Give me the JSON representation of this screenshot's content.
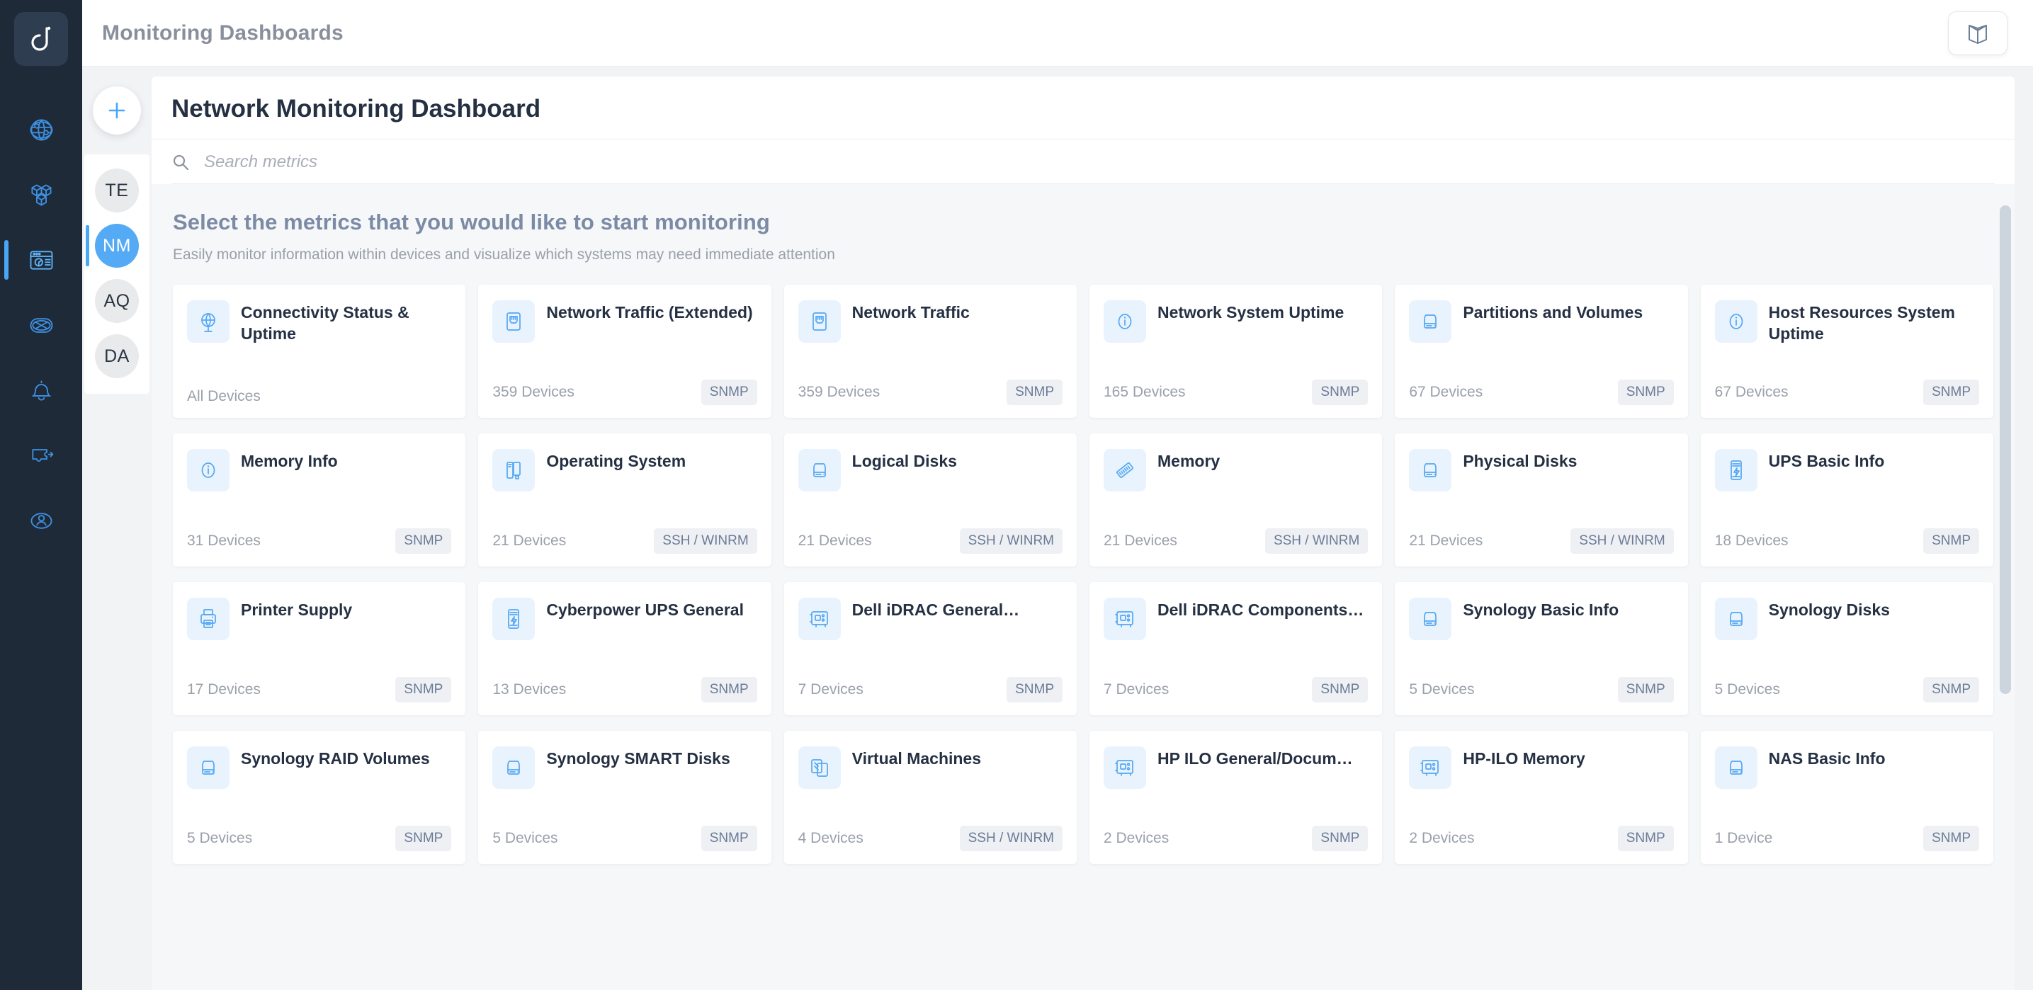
{
  "sidebar": {
    "logo": "logo-d-icon",
    "items": [
      {
        "name": "network",
        "icon": "globe-network-icon",
        "active": false
      },
      {
        "name": "inventory",
        "icon": "cubes-icon",
        "active": false
      },
      {
        "name": "dashboards",
        "icon": "dashboard-window-icon",
        "active": true
      },
      {
        "name": "discovery",
        "icon": "compass-icon",
        "active": false
      },
      {
        "name": "alerts",
        "icon": "bell-icon",
        "active": false
      },
      {
        "name": "integrations",
        "icon": "puzzle-piece-icon",
        "active": false
      },
      {
        "name": "account",
        "icon": "user-circle-icon",
        "active": false
      }
    ]
  },
  "topbar": {
    "title": "Monitoring Dashboards",
    "doc_button_icon": "book-icon"
  },
  "switcher": {
    "add_label": "+",
    "add_icon": "plus-icon",
    "dashboards": [
      {
        "initials": "TE",
        "active": false
      },
      {
        "initials": "NM",
        "active": true
      },
      {
        "initials": "AQ",
        "active": false
      },
      {
        "initials": "DA",
        "active": false
      }
    ]
  },
  "panel": {
    "title": "Network Monitoring Dashboard"
  },
  "search": {
    "placeholder": "Search metrics",
    "value": "",
    "icon": "search-icon"
  },
  "section": {
    "heading": "Select the metrics that you would like to start monitoring",
    "subheading": "Easily monitor information within devices and visualize which systems may need immediate attention"
  },
  "colors": {
    "accent": "#49a7f5",
    "rail_bg": "#1e2a38",
    "card_icon_bg": "#e9f3fe",
    "tag_bg": "#eef0f4",
    "heading": "#7c8ba5"
  },
  "metrics": [
    {
      "name": "Connectivity Status & Uptime",
      "devices": "All Devices",
      "tag": "",
      "icon": "globe-icon"
    },
    {
      "name": "Network Traffic (Extended)",
      "devices": "359 Devices",
      "tag": "SNMP",
      "icon": "ethernet-port-icon"
    },
    {
      "name": "Network Traffic",
      "devices": "359 Devices",
      "tag": "SNMP",
      "icon": "ethernet-port-icon"
    },
    {
      "name": "Network System Uptime",
      "devices": "165 Devices",
      "tag": "SNMP",
      "icon": "info-icon"
    },
    {
      "name": "Partitions and Volumes",
      "devices": "67 Devices",
      "tag": "SNMP",
      "icon": "disk-icon"
    },
    {
      "name": "Host Resources System Uptime",
      "devices": "67 Devices",
      "tag": "SNMP",
      "icon": "info-icon"
    },
    {
      "name": "Memory Info",
      "devices": "31 Devices",
      "tag": "SNMP",
      "icon": "info-icon"
    },
    {
      "name": "Operating System",
      "devices": "21 Devices",
      "tag": "SSH / WINRM",
      "icon": "os-window-icon"
    },
    {
      "name": "Logical Disks",
      "devices": "21 Devices",
      "tag": "SSH / WINRM",
      "icon": "disk-icon"
    },
    {
      "name": "Memory",
      "devices": "21 Devices",
      "tag": "SSH / WINRM",
      "icon": "memory-stick-icon"
    },
    {
      "name": "Physical Disks",
      "devices": "21 Devices",
      "tag": "SSH / WINRM",
      "icon": "disk-icon"
    },
    {
      "name": "UPS Basic Info",
      "devices": "18 Devices",
      "tag": "SNMP",
      "icon": "ups-battery-icon"
    },
    {
      "name": "Printer Supply",
      "devices": "17 Devices",
      "tag": "SNMP",
      "icon": "printer-icon"
    },
    {
      "name": "Cyberpower UPS General",
      "devices": "13 Devices",
      "tag": "SNMP",
      "icon": "ups-battery-icon"
    },
    {
      "name": "Dell iDRAC General…",
      "devices": "7 Devices",
      "tag": "SNMP",
      "icon": "board-chip-icon"
    },
    {
      "name": "Dell iDRAC Components…",
      "devices": "7 Devices",
      "tag": "SNMP",
      "icon": "board-chip-icon"
    },
    {
      "name": "Synology Basic Info",
      "devices": "5 Devices",
      "tag": "SNMP",
      "icon": "disk-icon"
    },
    {
      "name": "Synology Disks",
      "devices": "5 Devices",
      "tag": "SNMP",
      "icon": "disk-icon"
    },
    {
      "name": "Synology RAID Volumes",
      "devices": "5 Devices",
      "tag": "SNMP",
      "icon": "disk-icon"
    },
    {
      "name": "Synology SMART Disks",
      "devices": "5 Devices",
      "tag": "SNMP",
      "icon": "disk-icon"
    },
    {
      "name": "Virtual Machines",
      "devices": "4 Devices",
      "tag": "SSH / WINRM",
      "icon": "vm-stack-icon"
    },
    {
      "name": "HP ILO General/Docum…",
      "devices": "2 Devices",
      "tag": "SNMP",
      "icon": "board-chip-icon"
    },
    {
      "name": "HP-ILO Memory",
      "devices": "2 Devices",
      "tag": "SNMP",
      "icon": "board-chip-icon"
    },
    {
      "name": "NAS Basic Info",
      "devices": "1 Device",
      "tag": "SNMP",
      "icon": "disk-icon"
    }
  ]
}
